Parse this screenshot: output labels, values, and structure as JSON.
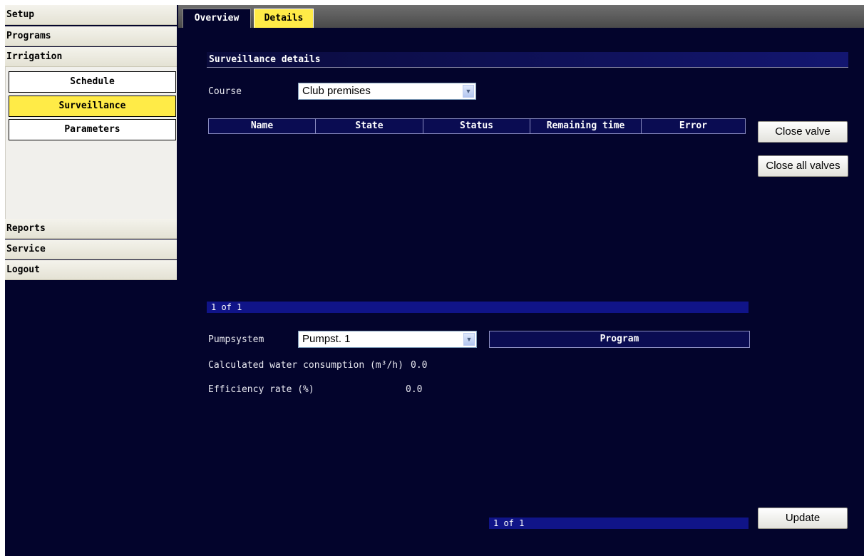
{
  "sidebar": {
    "menu": [
      "Setup",
      "Programs",
      "Irrigation"
    ],
    "sub_items": [
      "Schedule",
      "Surveillance",
      "Parameters"
    ],
    "bottom_menu": [
      "Reports",
      "Service",
      "Logout"
    ],
    "active_sub_item": "Surveillance"
  },
  "tabs": {
    "overview": "Overview",
    "details": "Details",
    "active": "Details"
  },
  "main": {
    "section_title": "Surveillance details",
    "course_label": "Course",
    "course_value": "Club premises",
    "table_headers": [
      "Name",
      "State",
      "Status",
      "Remaining time",
      "Error"
    ],
    "close_valve": "Close valve",
    "close_all_valves": "Close all valves",
    "pager1": "1 of 1",
    "pumpsystem_label": "Pumpsystem",
    "pumpsystem_value": "Pumpst. 1",
    "program_header": "Program",
    "water_label": "Calculated water consumption (m³/h)",
    "water_value": "0.0",
    "efficiency_label": "Efficiency rate (%)",
    "efficiency_value": "0.0",
    "pager2": "1 of 1",
    "update": "Update"
  },
  "colors": {
    "background": "#03042c",
    "highlight": "#ffeb47",
    "header_blue": "#0a0c52"
  },
  "icons": {
    "dropdown": "chevron-down-icon"
  }
}
